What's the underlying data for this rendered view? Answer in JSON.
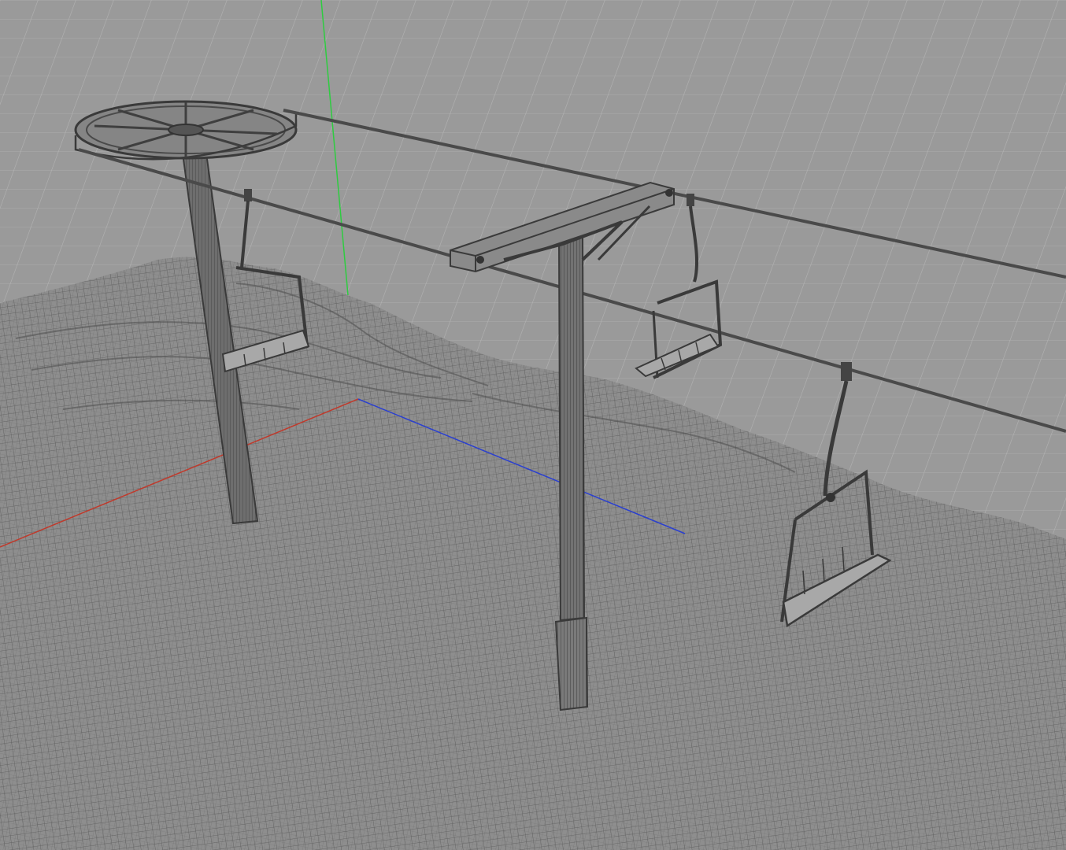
{
  "viewport": {
    "background": "#9a9a9a",
    "grid_color": "#b4b4b4",
    "wire_color": "#4a4a4a",
    "terrain_color": "#7e7e7e"
  },
  "axes": {
    "x_color": "#c0392b",
    "y_color": "#2ecc40",
    "z_color": "#2a3fd0"
  },
  "scene": {
    "objects": [
      "bullwheel-tower",
      "line-tower",
      "haul-cable",
      "return-cable",
      "chair-1",
      "chair-2",
      "chair-3",
      "terrain"
    ]
  }
}
